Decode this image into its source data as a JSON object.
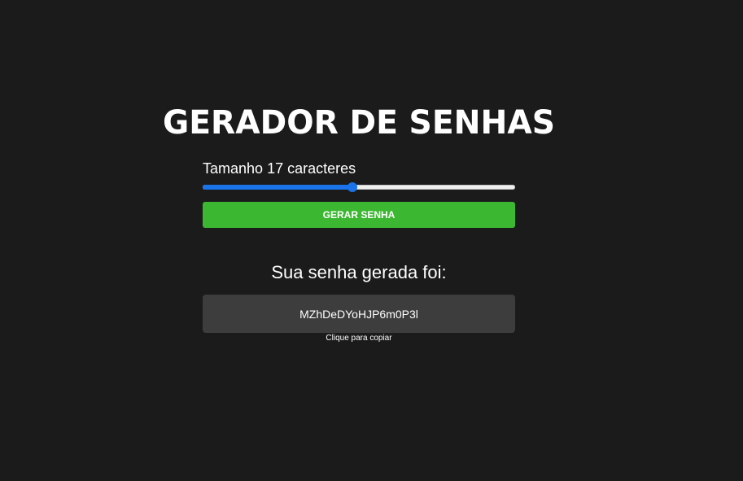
{
  "header": {
    "title": "GERADOR DE SENHAS"
  },
  "length": {
    "label_prefix": "Tamanho",
    "value": 17,
    "label_suffix": "caracteres",
    "slider_fraction": 0.48
  },
  "generate": {
    "button_label": "GERAR SENHA"
  },
  "result": {
    "title": "Sua senha gerada foi:",
    "password": "MZhDeDYoHJP6m0P3l",
    "copy_hint": "Clique para copiar"
  },
  "colors": {
    "background": "#1b1b1b",
    "accent_blue": "#1a73e8",
    "button_green": "#3cb731",
    "password_box": "#3d3d3d"
  }
}
